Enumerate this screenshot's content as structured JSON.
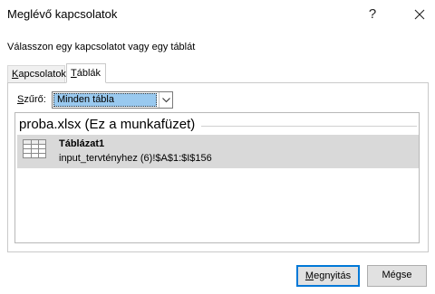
{
  "dialog": {
    "title": "Meglévő kapcsolatok",
    "help_label": "?",
    "instruction": "Válasszon egy kapcsolatot vagy egy táblát"
  },
  "tabs": [
    {
      "label_accel": "K",
      "label_rest": "apcsolatok",
      "selected": false
    },
    {
      "label_accel": "T",
      "label_rest": "áblák",
      "selected": true
    }
  ],
  "filter": {
    "label_accel": "S",
    "label_rest": "zűrő:",
    "selected_value": "Minden tábla"
  },
  "list": {
    "group_header": "proba.xlsx (Ez a munkafüzet)",
    "items": [
      {
        "name": "Táblázat1",
        "description": "input_tervtényhez (6)!$A$1:$I$156",
        "icon": "table-icon",
        "selected": true
      }
    ]
  },
  "buttons": {
    "open_accel": "M",
    "open_rest": "egnyitás",
    "cancel_label": "Mégse"
  },
  "colors": {
    "selection": "#99c9ef",
    "item_highlight": "#d9d9d9",
    "focus_border": "#0078d7"
  }
}
